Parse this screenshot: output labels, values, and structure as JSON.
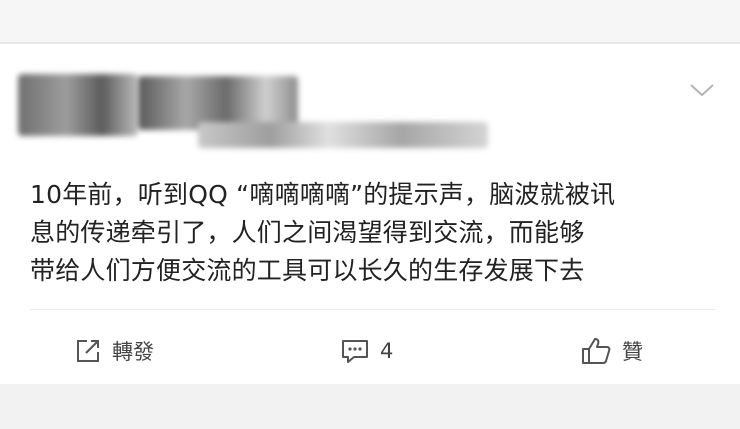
{
  "post": {
    "text_lines": [
      "10年前，听到QQ “嘀嘀嘀嘀”的提示声，脑波就被讯",
      "息的传递牵引了，人们之间渴望得到交流，而能够",
      "带给人们方便交流的工具可以长久的生存发展下去"
    ]
  },
  "actions": {
    "repost_label": "轉發",
    "comment_count": "4",
    "like_label": "贊"
  },
  "icons": {
    "menu": "chevron-down-icon",
    "repost": "share-edit-icon",
    "comment": "comment-bubble-icon",
    "like": "thumbs-up-icon"
  },
  "colors": {
    "page_bg": "#efefef",
    "card_bg": "#ffffff",
    "text": "#222222",
    "icon": "#444444"
  }
}
